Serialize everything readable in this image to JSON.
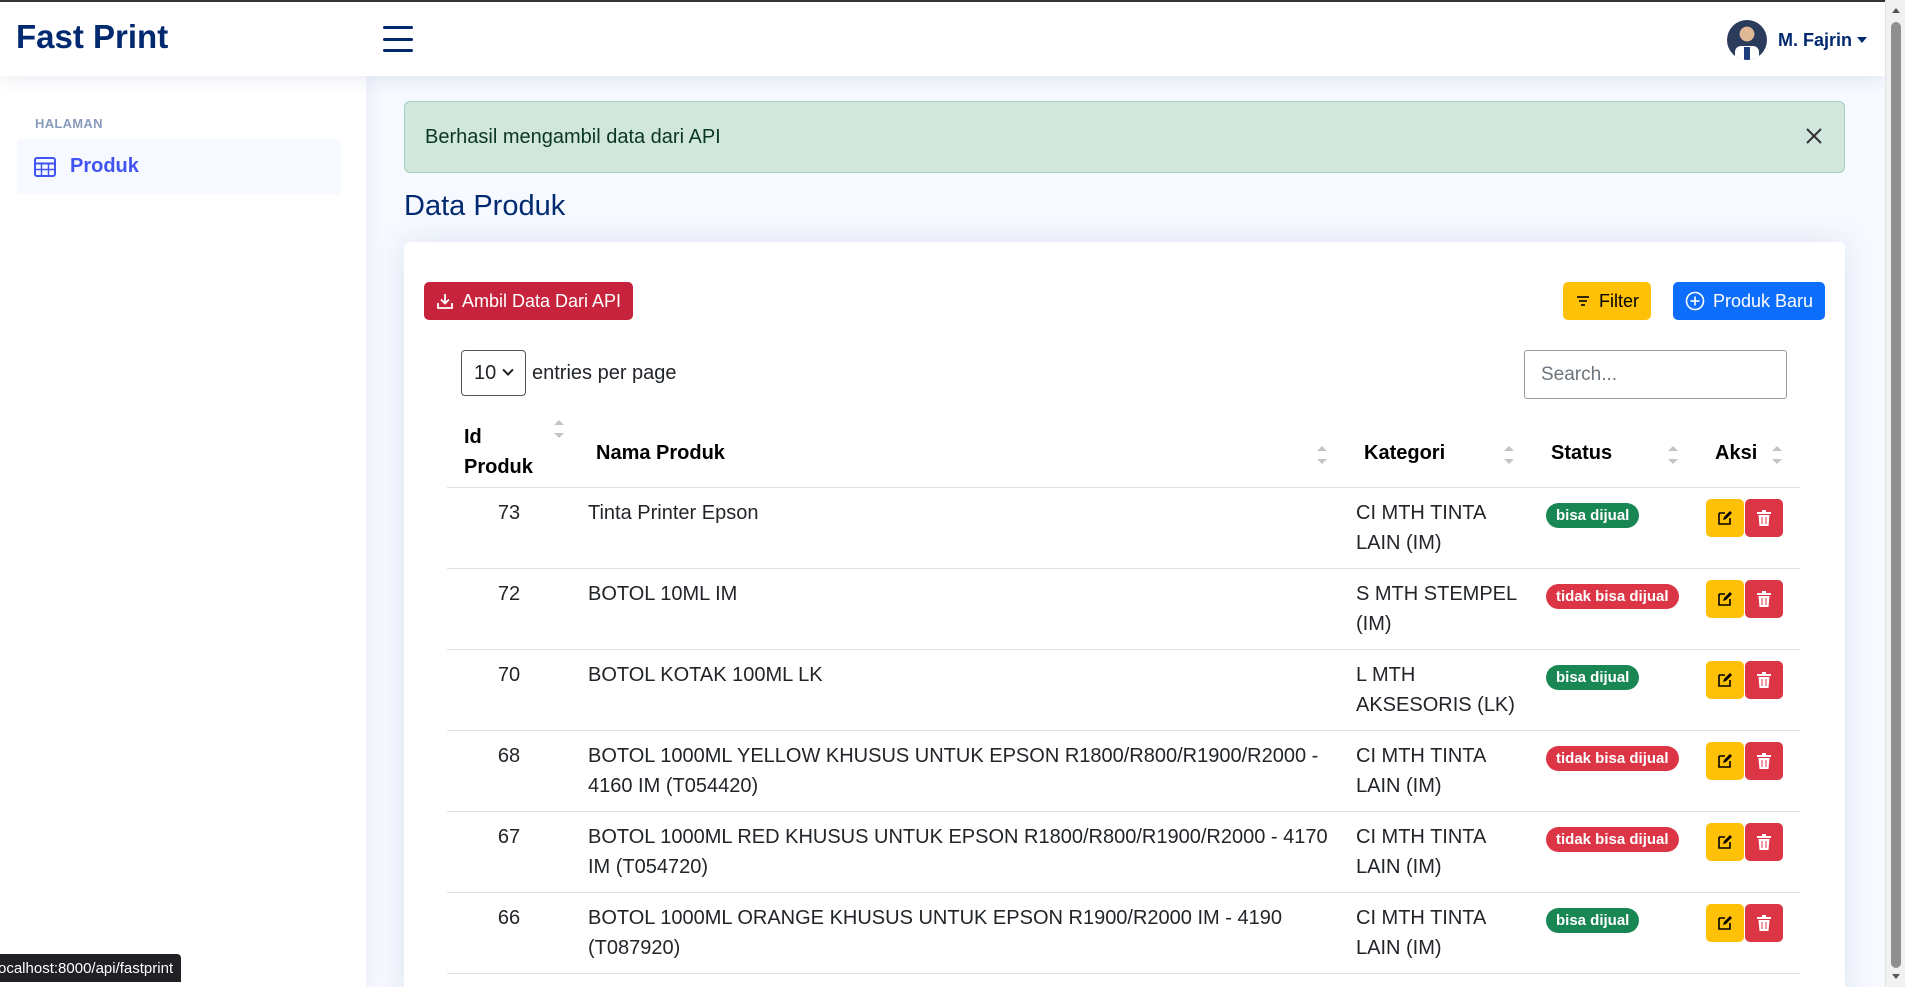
{
  "header": {
    "brand": "Fast Print",
    "user_name": "M. Fajrin"
  },
  "sidebar": {
    "heading": "HALAMAN",
    "items": [
      {
        "label": "Produk",
        "icon": "table-icon"
      }
    ]
  },
  "alert": {
    "message": "Berhasil mengambil data dari API"
  },
  "main": {
    "title": "Data Produk",
    "buttons": {
      "fetch_api": "Ambil Data Dari API",
      "filter": "Filter",
      "new_product": "Produk Baru"
    },
    "entries": {
      "value": "10",
      "label": "entries per page"
    },
    "search": {
      "placeholder": "Search..."
    },
    "table": {
      "columns": {
        "id_line1": "Id",
        "id_line2": "Produk",
        "name": "Nama Produk",
        "category": "Kategori",
        "status": "Status",
        "action": "Aksi"
      },
      "rows": [
        {
          "id": "73",
          "name": "Tinta Printer Epson",
          "category": "CI MTH TINTA LAIN (IM)",
          "status": "bisa dijual",
          "status_kind": "ok"
        },
        {
          "id": "72",
          "name": "BOTOL 10ML IM",
          "category": "S MTH STEMPEL (IM)",
          "status": "tidak bisa dijual",
          "status_kind": "no"
        },
        {
          "id": "70",
          "name": "BOTOL KOTAK 100ML LK",
          "category": "L MTH AKSESORIS (LK)",
          "status": "bisa dijual",
          "status_kind": "ok"
        },
        {
          "id": "68",
          "name": "BOTOL 1000ML YELLOW KHUSUS UNTUK EPSON R1800/R800/R1900/R2000 - 4160 IM (T054420)",
          "category": "CI MTH TINTA LAIN (IM)",
          "status": "tidak bisa dijual",
          "status_kind": "no"
        },
        {
          "id": "67",
          "name": "BOTOL 1000ML RED KHUSUS UNTUK EPSON R1800/R800/R1900/R2000 - 4170 IM (T054720)",
          "category": "CI MTH TINTA LAIN (IM)",
          "status": "tidak bisa dijual",
          "status_kind": "no"
        },
        {
          "id": "66",
          "name": "BOTOL 1000ML ORANGE KHUSUS UNTUK EPSON R1900/R2000 IM - 4190 (T087920)",
          "category": "CI MTH TINTA LAIN (IM)",
          "status": "bisa dijual",
          "status_kind": "ok"
        }
      ]
    }
  },
  "status_bar": {
    "url": "ocalhost:8000/api/fastprint"
  },
  "colors": {
    "brand": "#012970",
    "accent": "#4154f1",
    "success": "#198754",
    "danger": "#dc3545",
    "warning": "#ffc107",
    "primary": "#0d6efd"
  }
}
